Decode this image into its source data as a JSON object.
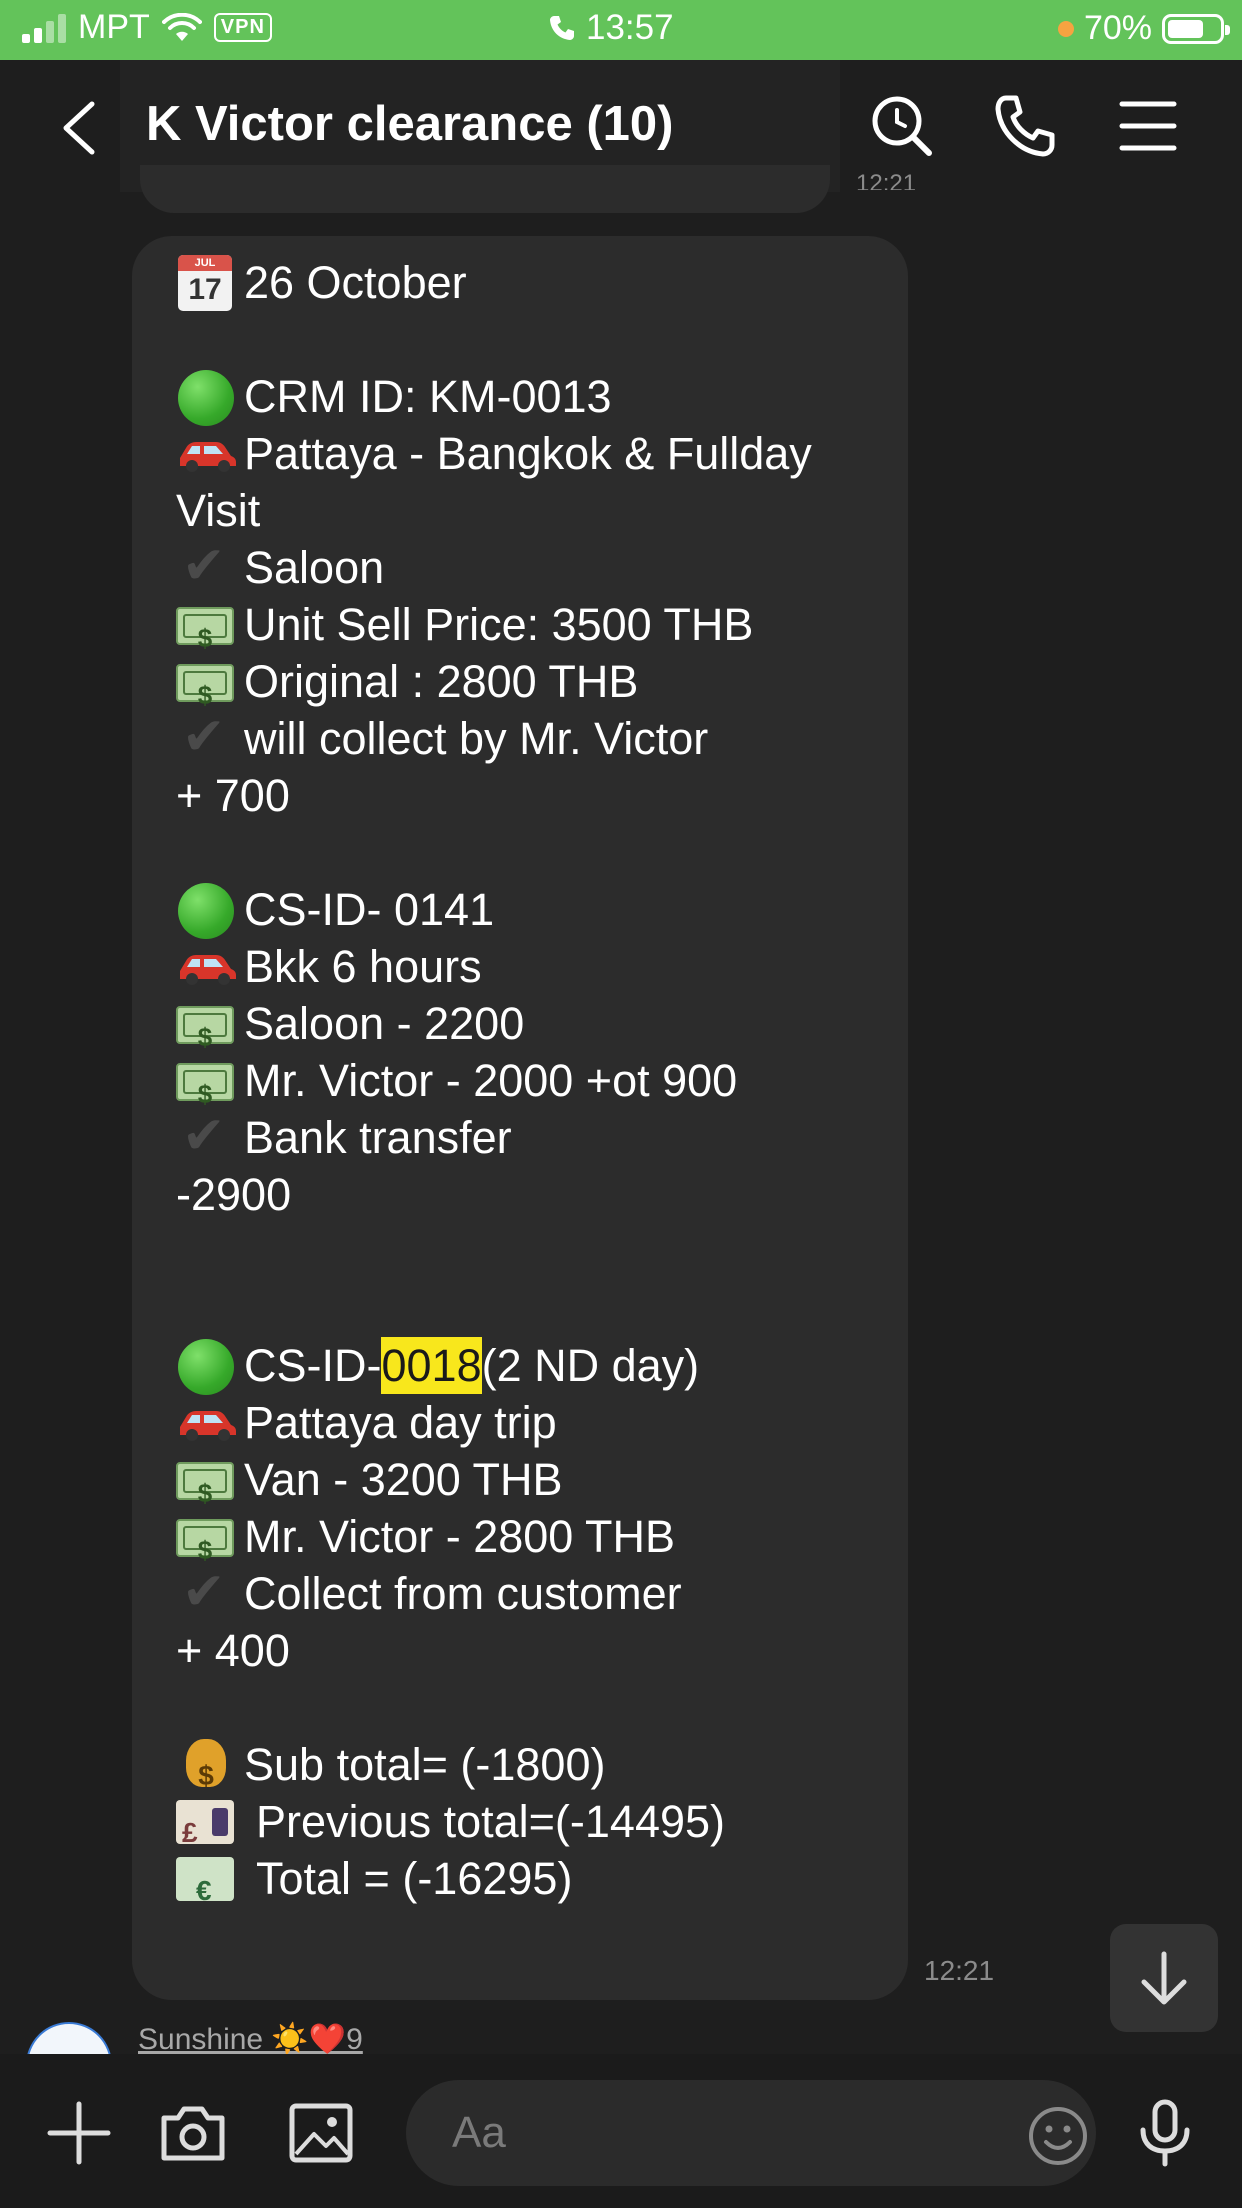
{
  "status_bar": {
    "carrier": "MPT",
    "vpn_label": "VPN",
    "time": "13:57",
    "battery_percent": "70%",
    "battery_level": 0.7
  },
  "header": {
    "title": "K Victor clearance  (10)"
  },
  "previous_message": {
    "time": "12:21"
  },
  "message": {
    "time": "12:21",
    "lines": [
      {
        "icon": "calendar",
        "text": "26 October"
      },
      {
        "icon": "",
        "text": ""
      },
      {
        "icon": "green-circle",
        "text": "CRM ID: KM-0013"
      },
      {
        "icon": "car",
        "text": "Pattaya - Bangkok & Fullday"
      },
      {
        "icon": "",
        "text": "Visit"
      },
      {
        "icon": "check",
        "text": "Saloon"
      },
      {
        "icon": "money",
        "text": "Unit Sell Price: 3500 THB"
      },
      {
        "icon": "money",
        "text": "Original : 2800 THB"
      },
      {
        "icon": "check",
        "text": "will collect by Mr. Victor"
      },
      {
        "icon": "",
        "text": "+ 700"
      },
      {
        "icon": "",
        "text": ""
      },
      {
        "icon": "green-circle",
        "text": "CS-ID- 0141"
      },
      {
        "icon": "car",
        "text": "Bkk 6 hours"
      },
      {
        "icon": "money",
        "text": "Saloon - 2200"
      },
      {
        "icon": "money",
        "text": "Mr. Victor - 2000 +ot 900"
      },
      {
        "icon": "check",
        "text": "Bank transfer"
      },
      {
        "icon": "",
        "text": "-2900"
      },
      {
        "icon": "",
        "text": ""
      },
      {
        "icon": "",
        "text": ""
      },
      {
        "icon": "green-circle",
        "text": "CS-ID-",
        "highlight": "0018",
        "after": "(2 ND day)"
      },
      {
        "icon": "car",
        "text": "Pattaya day trip"
      },
      {
        "icon": "money",
        "text": "Van  -  3200 THB"
      },
      {
        "icon": "money",
        "text": "Mr. Victor   -  2800 THB"
      },
      {
        "icon": "check",
        "text": "Collect from customer"
      },
      {
        "icon": "",
        "text": "+ 400"
      },
      {
        "icon": "",
        "text": ""
      },
      {
        "icon": "money-bag",
        "text": "Sub total= (-1800)"
      },
      {
        "icon": "pound-banknote",
        "text": "Previous total=(-14495)"
      },
      {
        "icon": "euro-banknote",
        "text": "Total = (-16295)"
      }
    ]
  },
  "next_sender": {
    "name": "Sunshine ☀️❤️9"
  },
  "input_bar": {
    "placeholder": "Aa"
  }
}
